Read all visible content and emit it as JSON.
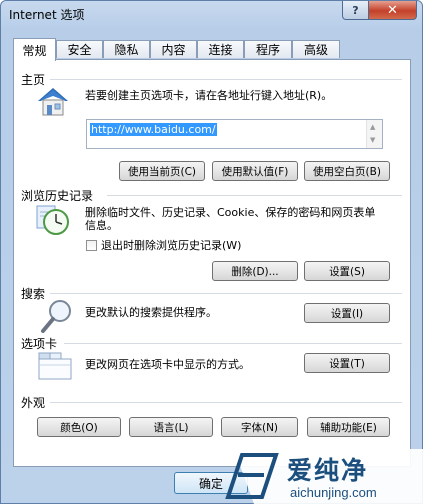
{
  "window": {
    "title": "Internet 选项",
    "help": "?",
    "close": "✕"
  },
  "tabs": [
    "常规",
    "安全",
    "隐私",
    "内容",
    "连接",
    "程序",
    "高级"
  ],
  "home": {
    "title": "主页",
    "desc": "若要创建主页选项卡，请在各地址行键入地址(R)。",
    "url": "http://www.baidu.com/",
    "btn_current": "使用当前页(C)",
    "btn_default": "使用默认值(F)",
    "btn_blank": "使用空白页(B)"
  },
  "history": {
    "title": "浏览历史记录",
    "desc": "删除临时文件、历史记录、Cookie、保存的密码和网页表单信息。",
    "checkbox_label": "退出时删除浏览历史记录(W)",
    "btn_delete": "删除(D)...",
    "btn_settings": "设置(S)"
  },
  "search": {
    "title": "搜索",
    "desc": "更改默认的搜索提供程序。",
    "btn_settings": "设置(I)"
  },
  "tabs_section": {
    "title": "选项卡",
    "desc": "更改网页在选项卡中显示的方式。",
    "btn_settings": "设置(T)"
  },
  "appearance": {
    "title": "外观",
    "btn_colors": "颜色(O)",
    "btn_languages": "语言(L)",
    "btn_fonts": "字体(N)",
    "btn_accessibility": "辅助功能(E)"
  },
  "footer": {
    "ok": "确定"
  },
  "watermark": {
    "text": "爱纯净",
    "url": "aichunjing.com"
  }
}
